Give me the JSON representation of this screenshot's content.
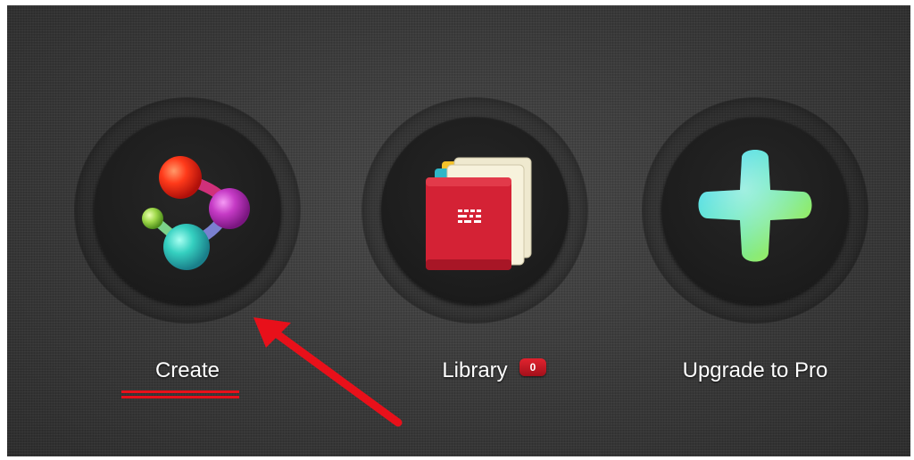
{
  "tiles": [
    {
      "label": "Create",
      "icon": "molecule-icon"
    },
    {
      "label": "Library",
      "icon": "folder-stack-icon",
      "badge": "0"
    },
    {
      "label": "Upgrade to Pro",
      "icon": "plus-icon"
    }
  ],
  "annotations": {
    "arrow_color": "#e8101a",
    "underline_color": "#e8101a"
  }
}
